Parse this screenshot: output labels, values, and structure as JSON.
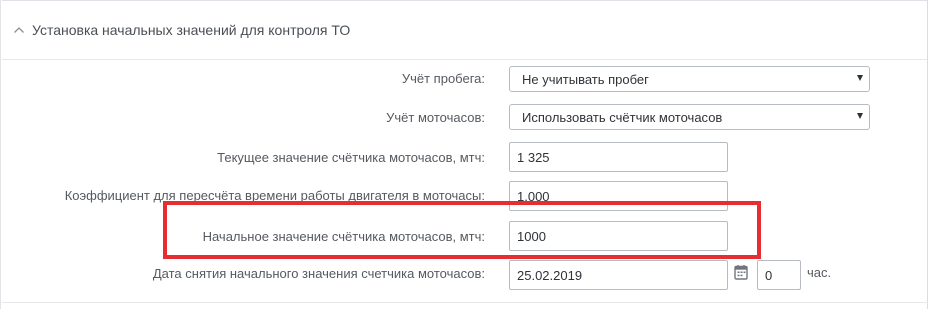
{
  "section": {
    "title": "Установка начальных значений для контроля ТО",
    "toggle_icon": "chevron-up-icon"
  },
  "form": {
    "mileage": {
      "label": "Учёт пробега:",
      "value": "Не учитывать пробег"
    },
    "engine_hours": {
      "label": "Учёт моточасов:",
      "value": "Использовать счётчик моточасов"
    },
    "current_counter": {
      "label": "Текущее значение счётчика моточасов, мтч:",
      "value": "1 325"
    },
    "coefficient": {
      "label": "Коэффициент для пересчёта времени работы двигателя в моточасы:",
      "value": "1.000"
    },
    "initial_counter": {
      "label": "Начальное значение счётчика моточасов, мтч:",
      "value": "1000"
    },
    "initial_date": {
      "label": "Дата снятия начального значения счетчика моточасов:",
      "value": "25.02.2019",
      "calendar_icon": "calendar-icon",
      "hours_value": "0",
      "hours_unit": "час."
    }
  },
  "annotation": {
    "highlight_color": "#e52d32"
  }
}
